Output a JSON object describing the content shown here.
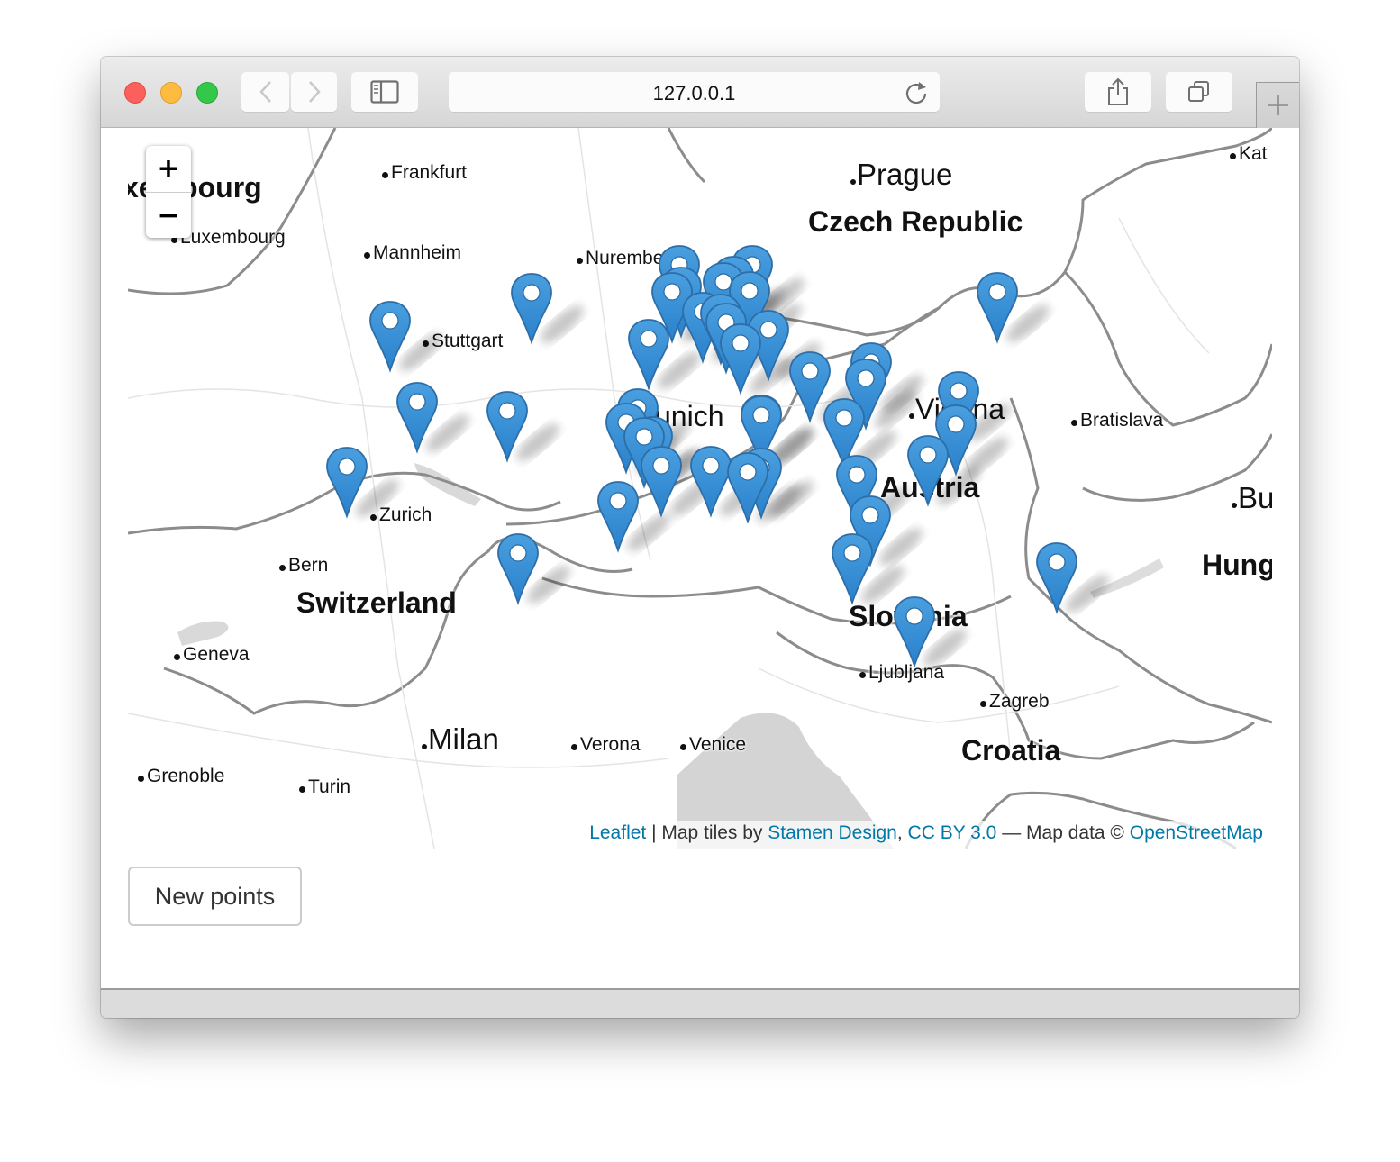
{
  "browser": {
    "url": "127.0.0.1",
    "traffic_lights": [
      "close",
      "minimize",
      "zoom"
    ],
    "toolbar_icons": [
      "back-icon",
      "forward-icon",
      "sidebar-icon",
      "reload-icon",
      "share-icon",
      "tabs-overview-icon",
      "new-tab-icon"
    ]
  },
  "map": {
    "zoom_in_label": "+",
    "zoom_out_label": "−",
    "marker_color": "#2a81cb",
    "marker_count": 43,
    "labels": {
      "cities": [
        "Frankfurt",
        "Luxembourg",
        "Mannheim",
        "Nuremberg",
        "Stuttgart",
        "Zurich",
        "Bern",
        "Geneva",
        "Grenoble",
        "Turin",
        "Verona",
        "Venice",
        "Ljubljana",
        "Zagreb",
        "Bratislava",
        "Kat"
      ],
      "big_cities": [
        "Prague",
        "Milan",
        "Bu"
      ],
      "countries": [
        "xembourg",
        "Czech Republic",
        "Switzerland",
        "Austria",
        "Slovenia",
        "Croatia",
        "Hung",
        "unich",
        "Vienna"
      ]
    },
    "attribution": {
      "leaflet": "Leaflet",
      "sep1": " | Map tiles by ",
      "stamen": "Stamen Design",
      "comma": ", ",
      "license": "CC BY 3.0",
      "sep2": " — Map data © ",
      "osm": "OpenStreetMap"
    }
  },
  "actions": {
    "new_points_label": "New points"
  }
}
